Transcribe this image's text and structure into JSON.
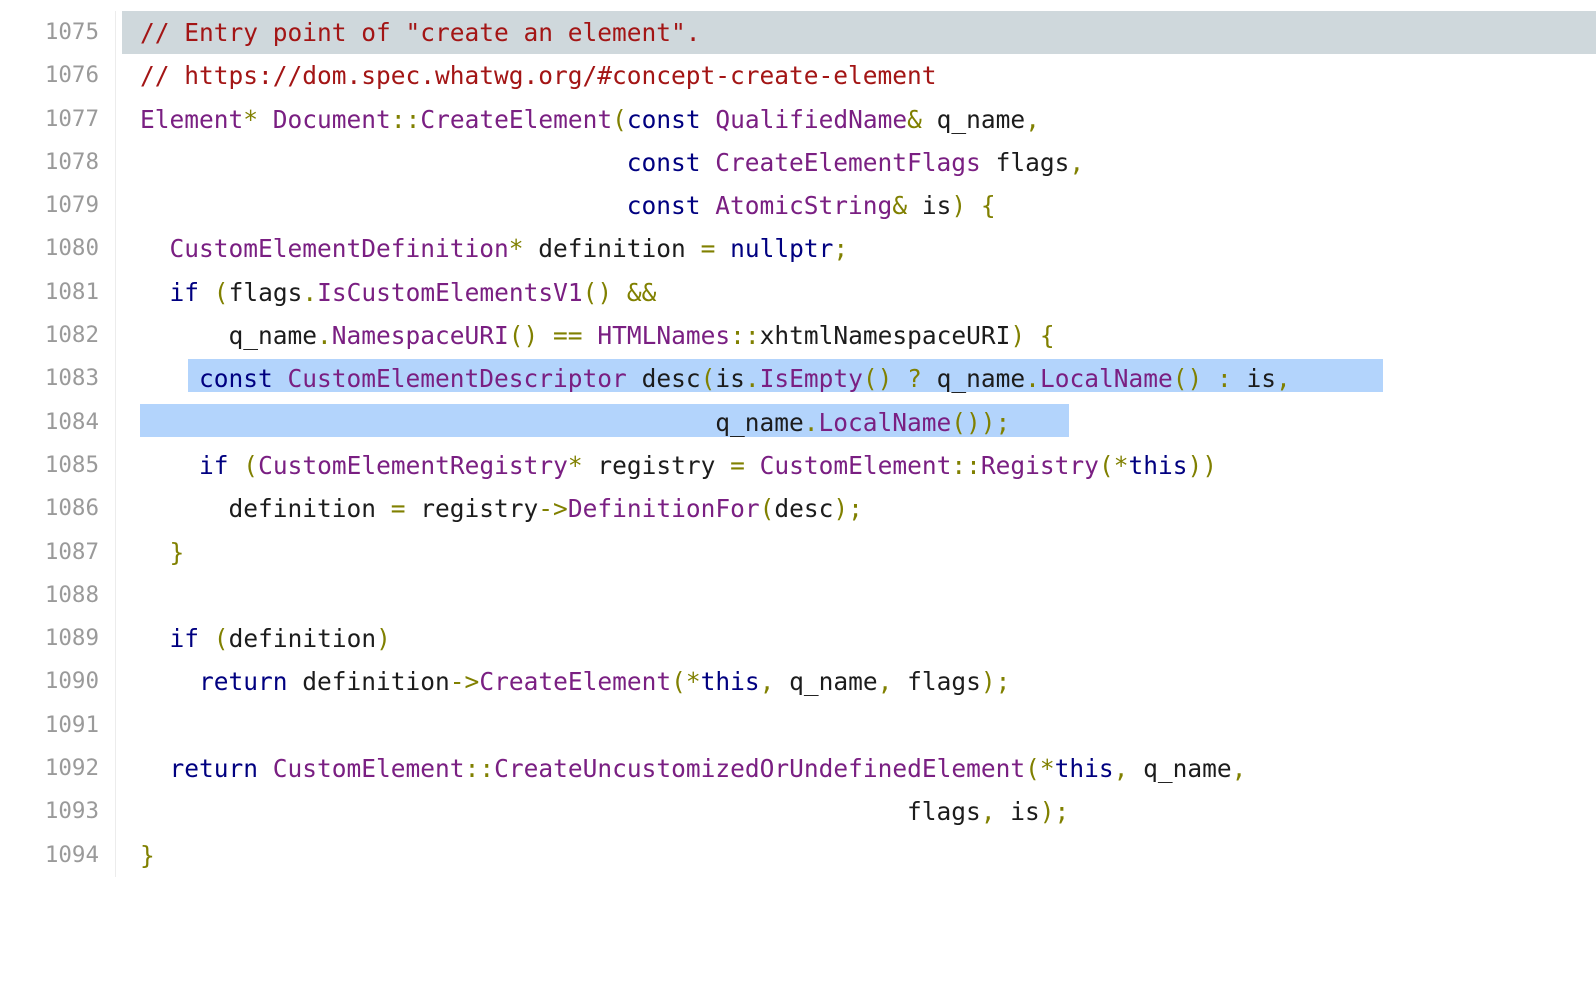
{
  "colors": {
    "comment": "#a31515",
    "keyword": "#000080",
    "type": "#7a1f82",
    "function": "#7a1f82",
    "punctuation": "#808000",
    "identifier": "#1c1c1c",
    "line_number": "#9a9a9a",
    "current_line_bg": "#cfd8dc",
    "selection_bg": "#b3d4fc"
  },
  "code_view": {
    "lines": [
      {
        "number": "1075",
        "tokens": [
          {
            "t": "c",
            "v": "// Entry point of \"create an element\"."
          }
        ]
      },
      {
        "number": "1076",
        "tokens": [
          {
            "t": "c",
            "v": "// https://dom.spec.whatwg.org/#concept-create-element"
          }
        ]
      },
      {
        "number": "1077",
        "tokens": [
          {
            "t": "t",
            "v": "Element"
          },
          {
            "t": "p",
            "v": "*"
          },
          {
            "t": "i",
            "v": " "
          },
          {
            "t": "t",
            "v": "Document"
          },
          {
            "t": "p",
            "v": "::"
          },
          {
            "t": "f",
            "v": "CreateElement"
          },
          {
            "t": "p",
            "v": "("
          },
          {
            "t": "k",
            "v": "const"
          },
          {
            "t": "i",
            "v": " "
          },
          {
            "t": "t",
            "v": "QualifiedName"
          },
          {
            "t": "p",
            "v": "&"
          },
          {
            "t": "i",
            "v": " q_name"
          },
          {
            "t": "p",
            "v": ","
          }
        ]
      },
      {
        "number": "1078",
        "tokens": [
          {
            "t": "i",
            "v": "                                 "
          },
          {
            "t": "k",
            "v": "const"
          },
          {
            "t": "i",
            "v": " "
          },
          {
            "t": "t",
            "v": "CreateElementFlags"
          },
          {
            "t": "i",
            "v": " flags"
          },
          {
            "t": "p",
            "v": ","
          }
        ]
      },
      {
        "number": "1079",
        "tokens": [
          {
            "t": "i",
            "v": "                                 "
          },
          {
            "t": "k",
            "v": "const"
          },
          {
            "t": "i",
            "v": " "
          },
          {
            "t": "t",
            "v": "AtomicString"
          },
          {
            "t": "p",
            "v": "&"
          },
          {
            "t": "i",
            "v": " is"
          },
          {
            "t": "p",
            "v": ") {"
          }
        ]
      },
      {
        "number": "1080",
        "tokens": [
          {
            "t": "i",
            "v": "  "
          },
          {
            "t": "t",
            "v": "CustomElementDefinition"
          },
          {
            "t": "p",
            "v": "*"
          },
          {
            "t": "i",
            "v": " definition "
          },
          {
            "t": "p",
            "v": "="
          },
          {
            "t": "i",
            "v": " "
          },
          {
            "t": "k",
            "v": "nullptr"
          },
          {
            "t": "p",
            "v": ";"
          }
        ]
      },
      {
        "number": "1081",
        "tokens": [
          {
            "t": "i",
            "v": "  "
          },
          {
            "t": "k",
            "v": "if"
          },
          {
            "t": "i",
            "v": " "
          },
          {
            "t": "p",
            "v": "("
          },
          {
            "t": "i",
            "v": "flags"
          },
          {
            "t": "p",
            "v": "."
          },
          {
            "t": "f",
            "v": "IsCustomElementsV1"
          },
          {
            "t": "p",
            "v": "() &&"
          }
        ]
      },
      {
        "number": "1082",
        "tokens": [
          {
            "t": "i",
            "v": "      q_name"
          },
          {
            "t": "p",
            "v": "."
          },
          {
            "t": "f",
            "v": "NamespaceURI"
          },
          {
            "t": "p",
            "v": "() =="
          },
          {
            "t": "i",
            "v": " "
          },
          {
            "t": "t",
            "v": "HTMLNames"
          },
          {
            "t": "p",
            "v": "::"
          },
          {
            "t": "i",
            "v": "xhtmlNamespaceURI"
          },
          {
            "t": "p",
            "v": ") {"
          }
        ]
      },
      {
        "number": "1083",
        "tokens": [
          {
            "t": "i",
            "v": "    "
          },
          {
            "t": "k",
            "v": "const"
          },
          {
            "t": "i",
            "v": " "
          },
          {
            "t": "t",
            "v": "CustomElementDescriptor"
          },
          {
            "t": "i",
            "v": " desc"
          },
          {
            "t": "p",
            "v": "("
          },
          {
            "t": "i",
            "v": "is"
          },
          {
            "t": "p",
            "v": "."
          },
          {
            "t": "f",
            "v": "IsEmpty"
          },
          {
            "t": "p",
            "v": "() ?"
          },
          {
            "t": "i",
            "v": " q_name"
          },
          {
            "t": "p",
            "v": "."
          },
          {
            "t": "f",
            "v": "LocalName"
          },
          {
            "t": "p",
            "v": "() :"
          },
          {
            "t": "i",
            "v": " is"
          },
          {
            "t": "p",
            "v": ","
          }
        ]
      },
      {
        "number": "1084",
        "tokens": [
          {
            "t": "i",
            "v": "                                       q_name"
          },
          {
            "t": "p",
            "v": "."
          },
          {
            "t": "f",
            "v": "LocalName"
          },
          {
            "t": "p",
            "v": "());"
          }
        ]
      },
      {
        "number": "1085",
        "tokens": [
          {
            "t": "i",
            "v": "    "
          },
          {
            "t": "k",
            "v": "if"
          },
          {
            "t": "i",
            "v": " "
          },
          {
            "t": "p",
            "v": "("
          },
          {
            "t": "t",
            "v": "CustomElementRegistry"
          },
          {
            "t": "p",
            "v": "*"
          },
          {
            "t": "i",
            "v": " registry "
          },
          {
            "t": "p",
            "v": "="
          },
          {
            "t": "i",
            "v": " "
          },
          {
            "t": "t",
            "v": "CustomElement"
          },
          {
            "t": "p",
            "v": "::"
          },
          {
            "t": "f",
            "v": "Registry"
          },
          {
            "t": "p",
            "v": "(*"
          },
          {
            "t": "k",
            "v": "this"
          },
          {
            "t": "p",
            "v": "))"
          }
        ]
      },
      {
        "number": "1086",
        "tokens": [
          {
            "t": "i",
            "v": "      definition "
          },
          {
            "t": "p",
            "v": "="
          },
          {
            "t": "i",
            "v": " registry"
          },
          {
            "t": "p",
            "v": "->"
          },
          {
            "t": "f",
            "v": "DefinitionFor"
          },
          {
            "t": "p",
            "v": "("
          },
          {
            "t": "i",
            "v": "desc"
          },
          {
            "t": "p",
            "v": ");"
          }
        ]
      },
      {
        "number": "1087",
        "tokens": [
          {
            "t": "i",
            "v": "  "
          },
          {
            "t": "p",
            "v": "}"
          }
        ]
      },
      {
        "number": "1088",
        "tokens": []
      },
      {
        "number": "1089",
        "tokens": [
          {
            "t": "i",
            "v": "  "
          },
          {
            "t": "k",
            "v": "if"
          },
          {
            "t": "i",
            "v": " "
          },
          {
            "t": "p",
            "v": "("
          },
          {
            "t": "i",
            "v": "definition"
          },
          {
            "t": "p",
            "v": ")"
          }
        ]
      },
      {
        "number": "1090",
        "tokens": [
          {
            "t": "i",
            "v": "    "
          },
          {
            "t": "k",
            "v": "return"
          },
          {
            "t": "i",
            "v": " definition"
          },
          {
            "t": "p",
            "v": "->"
          },
          {
            "t": "f",
            "v": "CreateElement"
          },
          {
            "t": "p",
            "v": "(*"
          },
          {
            "t": "k",
            "v": "this"
          },
          {
            "t": "p",
            "v": ","
          },
          {
            "t": "i",
            "v": " q_name"
          },
          {
            "t": "p",
            "v": ","
          },
          {
            "t": "i",
            "v": " flags"
          },
          {
            "t": "p",
            "v": ");"
          }
        ]
      },
      {
        "number": "1091",
        "tokens": []
      },
      {
        "number": "1092",
        "tokens": [
          {
            "t": "i",
            "v": "  "
          },
          {
            "t": "k",
            "v": "return"
          },
          {
            "t": "i",
            "v": " "
          },
          {
            "t": "t",
            "v": "CustomElement"
          },
          {
            "t": "p",
            "v": "::"
          },
          {
            "t": "f",
            "v": "CreateUncustomizedOrUndefinedElement"
          },
          {
            "t": "p",
            "v": "(*"
          },
          {
            "t": "k",
            "v": "this"
          },
          {
            "t": "p",
            "v": ","
          },
          {
            "t": "i",
            "v": " q_name"
          },
          {
            "t": "p",
            "v": ","
          }
        ]
      },
      {
        "number": "1093",
        "tokens": [
          {
            "t": "i",
            "v": "                                                    flags"
          },
          {
            "t": "p",
            "v": ","
          },
          {
            "t": "i",
            "v": " is"
          },
          {
            "t": "p",
            "v": ");"
          }
        ]
      },
      {
        "number": "1094",
        "tokens": [
          {
            "t": "p",
            "v": "}"
          }
        ]
      }
    ]
  }
}
